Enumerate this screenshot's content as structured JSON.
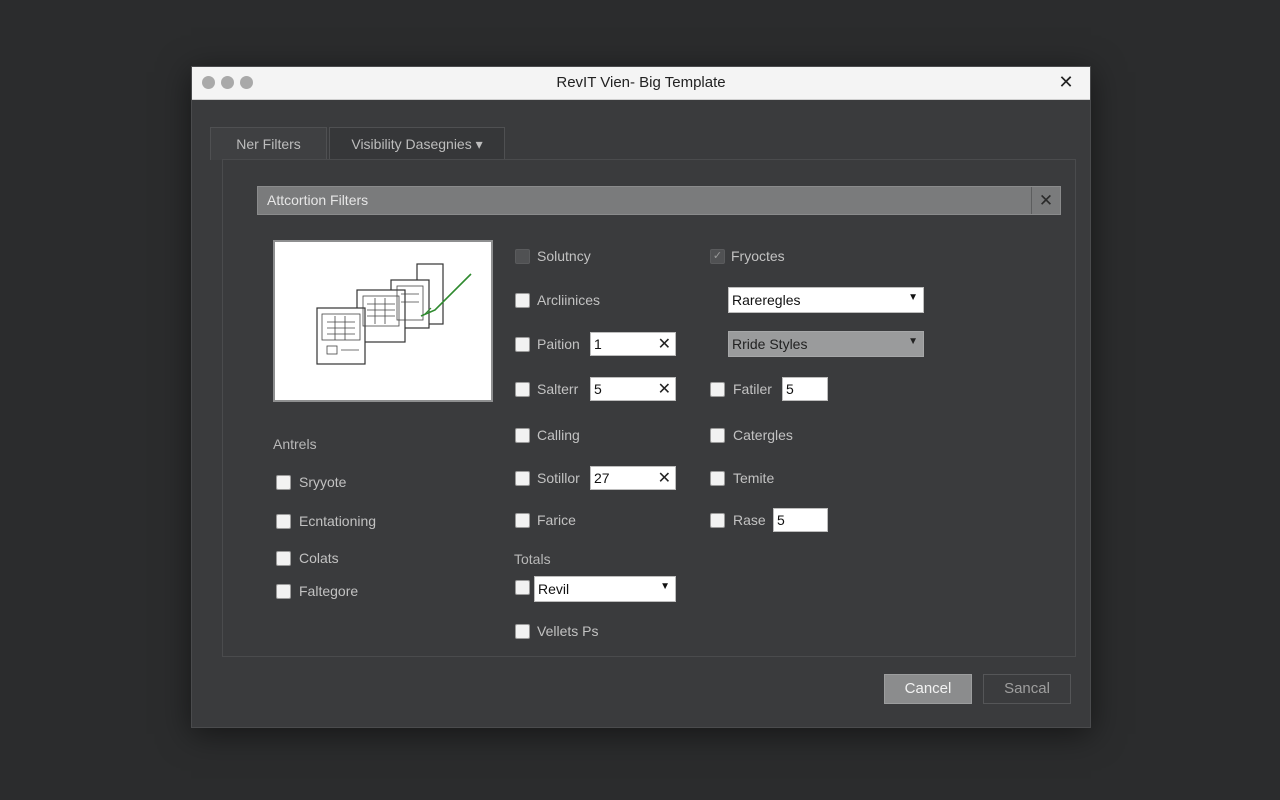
{
  "window": {
    "title": "RevIT Vien- Big Template",
    "close_icon": "close-icon"
  },
  "tabs": [
    {
      "label": "Ner Filters"
    },
    {
      "label": "Visibility Dasegnies ▾"
    }
  ],
  "filter_bar": {
    "label": "Attcortion Filters",
    "clear_icon": "close-icon"
  },
  "left": {
    "heading": "Antrels",
    "items": [
      {
        "label": "Sryyote"
      },
      {
        "label": "Ecntationing"
      },
      {
        "label": "Colats"
      },
      {
        "label": "Faltegore"
      }
    ]
  },
  "middle": {
    "items": [
      {
        "label": "Solutncy"
      },
      {
        "label": "Arcliinices"
      },
      {
        "label": "Paition",
        "value": "1"
      },
      {
        "label": "Salterr",
        "value": "5"
      },
      {
        "label": "Calling"
      },
      {
        "label": "Sotillor",
        "value": "27"
      },
      {
        "label": "Farice"
      }
    ],
    "totals_heading": "Totals",
    "totals_select": "Revil",
    "last_item": "Vellets Ps"
  },
  "right": {
    "checked_item": "Fryoctes",
    "select_1": "Rareregles",
    "select_2": "Rride Styles",
    "items": [
      {
        "label": "Fatiler",
        "value": "5"
      },
      {
        "label": "Catergles"
      },
      {
        "label": "Temite"
      },
      {
        "label": "Rase",
        "value": "5"
      }
    ]
  },
  "buttons": {
    "cancel": "Cancel",
    "secondary": "Sancal"
  },
  "colors": {
    "background": "#2b2c2d",
    "dialog": "#3a3b3d",
    "titlebar": "#f4f4f4",
    "primary_button": "#8b8c8d"
  }
}
